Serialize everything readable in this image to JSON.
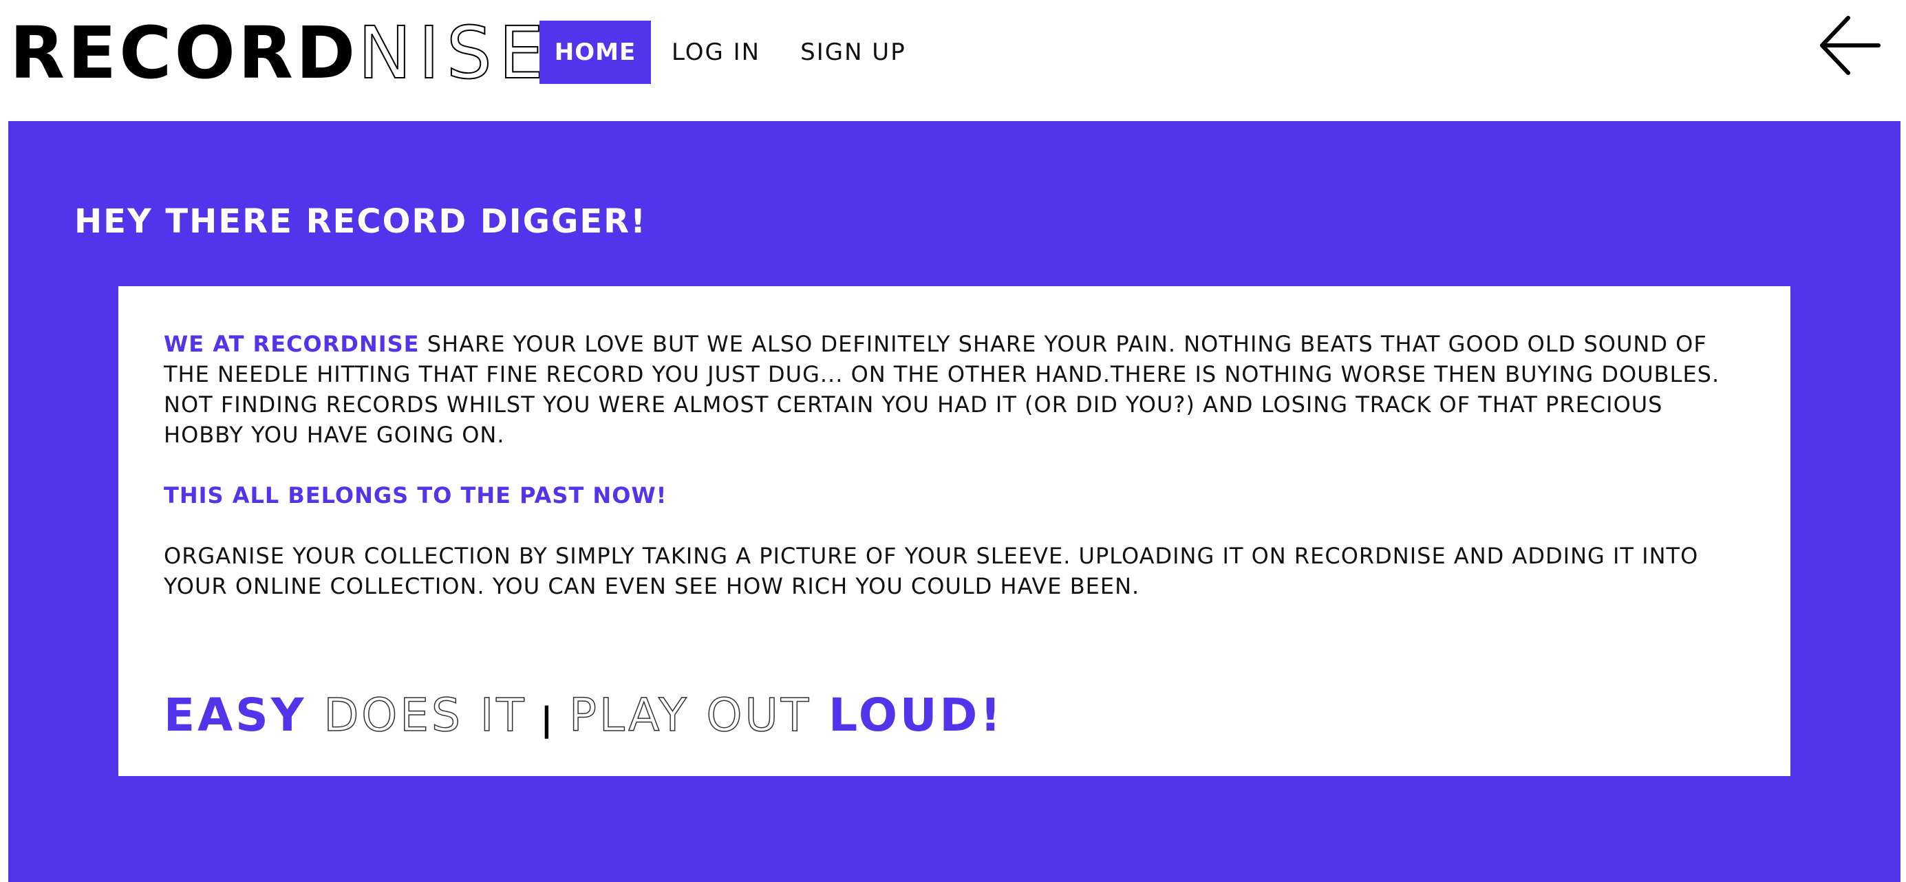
{
  "header": {
    "logo_bold": "RECORD",
    "logo_thin": "NISE",
    "nav": {
      "home": "HOME",
      "login": "LOG IN",
      "signup": "SIGN UP"
    },
    "back_icon": "arrow-left-icon"
  },
  "hero": {
    "title": "HEY THERE RECORD DIGGER!",
    "paragraph1_highlight": "WE AT RECORDNISE",
    "paragraph1_rest": " SHARE YOUR LOVE BUT WE ALSO DEFINITELY SHARE YOUR PAIN. NOTHING BEATS THAT GOOD OLD SOUND OF THE NEEDLE HITTING THAT FINE RECORD YOU JUST DUG... ON THE OTHER HAND.THERE IS NOTHING WORSE THEN BUYING DOUBLES. NOT FINDING RECORDS WHILST YOU WERE ALMOST CERTAIN YOU HAD IT (OR DID YOU?) AND LOSING TRACK OF THAT PRECIOUS HOBBY YOU HAVE GOING ON.",
    "paragraph2": "THIS ALL BELONGS TO THE PAST NOW!",
    "paragraph3": "ORGANISE YOUR COLLECTION BY SIMPLY TAKING A PICTURE OF YOUR SLEEVE. UPLOADING IT ON RECORDNISE AND ADDING IT INTO YOUR ONLINE COLLECTION. YOU CAN EVEN SEE HOW RICH YOU COULD HAVE BEEN.",
    "tagline": {
      "easy": "EASY",
      "does_it": "DOES IT",
      "separator": "|",
      "play_out": "PLAY OUT",
      "loud": "LOUD!"
    }
  },
  "colors": {
    "accent": "#5234ea",
    "text": "#111111",
    "background": "#ffffff"
  }
}
